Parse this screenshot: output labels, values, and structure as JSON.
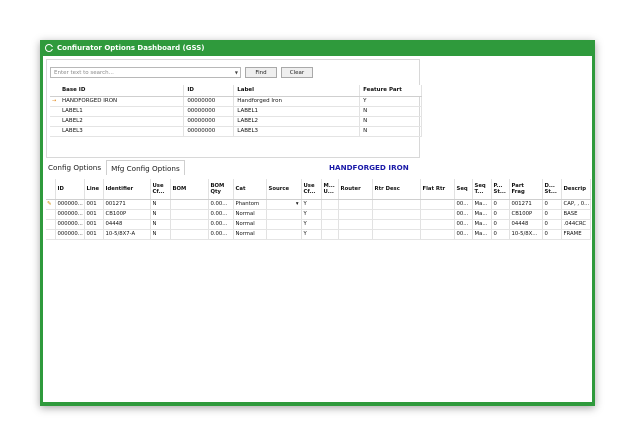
{
  "window": {
    "title": "Confiurator Options Dashboard (GSS)"
  },
  "search": {
    "placeholder": "Enter text to search...",
    "find_label": "Find",
    "clear_label": "Clear"
  },
  "base_grid": {
    "headers": [
      "Base ID",
      "ID",
      "Label",
      "Feature Part"
    ],
    "rows": [
      {
        "current": true,
        "cells": [
          "HANDFORGED IRON",
          "00000000",
          "Handforged Iron",
          "Y"
        ]
      },
      {
        "current": false,
        "cells": [
          "LABEL1",
          "00000000",
          "LABEL1",
          "N"
        ]
      },
      {
        "current": false,
        "cells": [
          "LABEL2",
          "00000000",
          "LABEL2",
          "N"
        ]
      },
      {
        "current": false,
        "cells": [
          "LABEL3",
          "00000000",
          "LABEL3",
          "N"
        ]
      }
    ]
  },
  "tabs": [
    {
      "label": "Config Options",
      "active": false
    },
    {
      "label": "Mfg Config Options",
      "active": true
    }
  ],
  "selected_base": "HANDFORGED IRON",
  "mfg_grid": {
    "headers": [
      "ID",
      "Line",
      "Identifier",
      "Use\nCf...",
      "BOM",
      "BOM\nQty",
      "Cat",
      "Source",
      "Use\nCf...",
      "M...\nU...",
      "Router",
      "Rtr Desc",
      "Flat Rtr",
      "Seq",
      "Seq\nT...",
      "P...\nSt...",
      "Part\nFrag",
      "D...\nSt...",
      "Descrip"
    ],
    "rows": [
      {
        "editing": true,
        "cells": [
          "000000...",
          "001",
          "001271",
          "N",
          "",
          "0.00...",
          "Phantom",
          "",
          "Y",
          "",
          "",
          "",
          "",
          "00...",
          "Ma...",
          "0",
          "001271",
          "0",
          "CAP, , 0..."
        ]
      },
      {
        "editing": false,
        "cells": [
          "000000...",
          "001",
          "CB100P",
          "N",
          "",
          "0.00...",
          "Normal",
          "",
          "Y",
          "",
          "",
          "",
          "",
          "00...",
          "Ma...",
          "0",
          "CB100P",
          "0",
          "BASE"
        ]
      },
      {
        "editing": false,
        "cells": [
          "000000...",
          "001",
          "04448",
          "N",
          "",
          "0.00...",
          "Normal",
          "",
          "Y",
          "",
          "",
          "",
          "",
          "00...",
          "Ma...",
          "0",
          "04448",
          "0",
          ".044CRC"
        ]
      },
      {
        "editing": false,
        "cells": [
          "000000...",
          "001",
          "10-5/8X7-A",
          "N",
          "",
          "0.00...",
          "Normal",
          "",
          "Y",
          "",
          "",
          "",
          "",
          "00...",
          "Ma...",
          "0",
          "10-5/8X...",
          "0",
          "FRAME"
        ]
      }
    ]
  },
  "colors": {
    "frame": "#2f9a3c",
    "accent_text": "#1a1aa8",
    "row_indicator": "#e07c00"
  }
}
